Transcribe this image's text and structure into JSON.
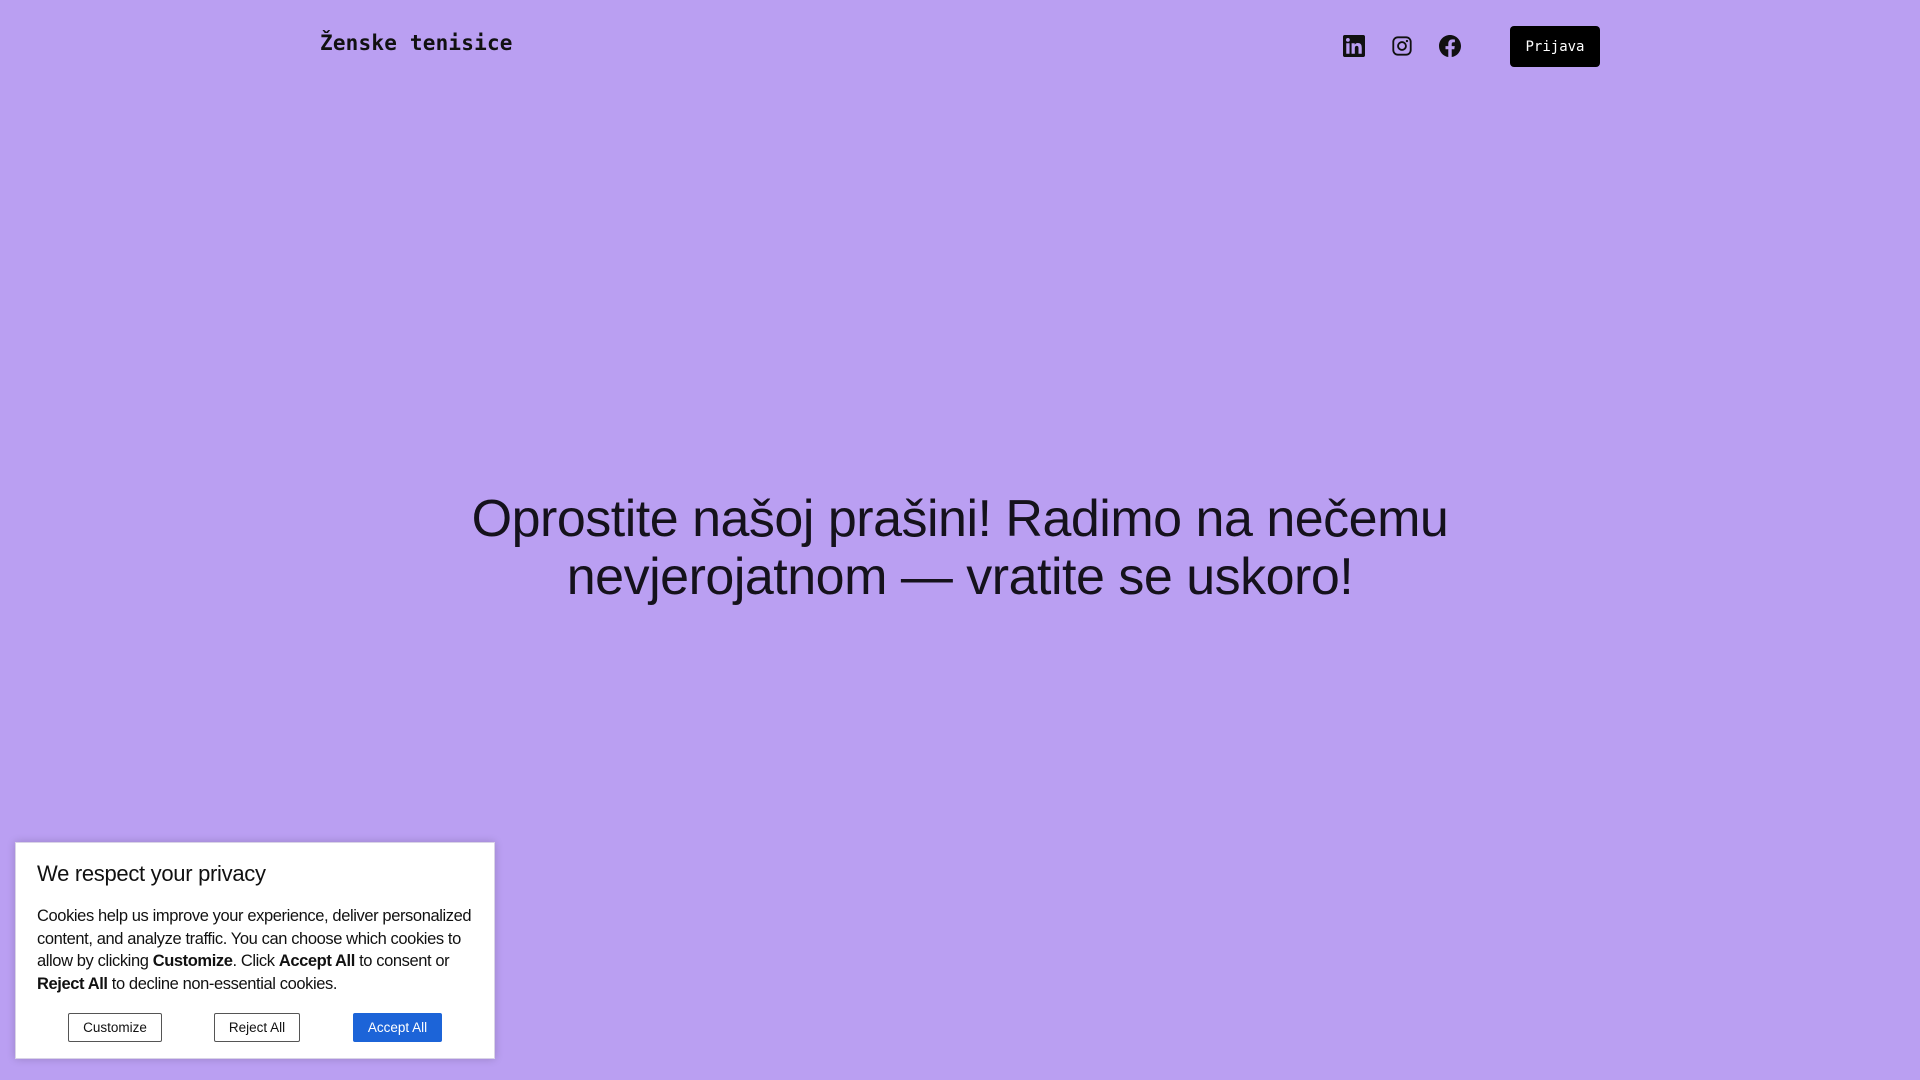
{
  "header": {
    "site_title": "Ženske tenisice",
    "login_label": "Prijava",
    "social": [
      {
        "icon": "linkedin-icon"
      },
      {
        "icon": "instagram-icon"
      },
      {
        "icon": "facebook-icon"
      }
    ]
  },
  "hero": {
    "line1": "Oprostite našoj prašini! Radimo na nečemu",
    "line2": "nevjerojatnom — vratite se uskoro!"
  },
  "cookie_banner": {
    "title": "We respect your privacy",
    "text": {
      "part1": "Cookies help us improve your experience, deliver personalized content, and analyze traffic. You can choose which cookies to allow by clicking ",
      "customize_bold": "Customize",
      "part2": ". Click ",
      "accept_bold": "Accept All",
      "part3": " to consent or ",
      "reject_bold": "Reject All",
      "part4": " to decline non-essential cookies."
    },
    "buttons": {
      "customize": "Customize",
      "reject": "Reject All",
      "accept": "Accept All"
    }
  },
  "colors": {
    "background": "#ba9ff2",
    "login_button": "#000000",
    "accept_button": "#1c64d8"
  }
}
